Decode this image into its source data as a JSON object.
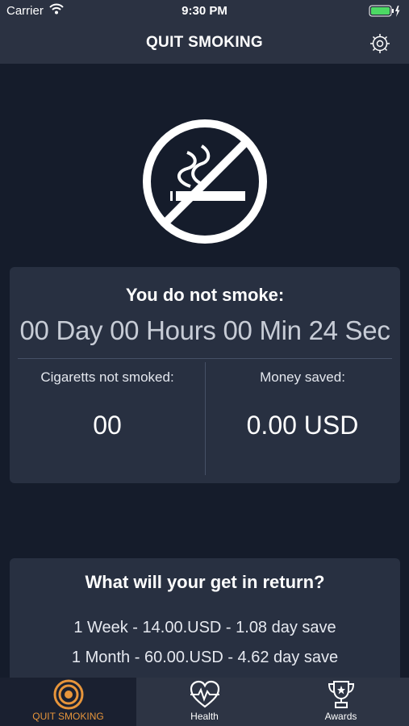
{
  "status_bar": {
    "carrier": "Carrier",
    "time": "9:30 PM"
  },
  "nav": {
    "title": "QUIT SMOKING"
  },
  "main": {
    "you_do_not_smoke_label": "You do not smoke:",
    "timer": "00 Day 00 Hours 00 Min 24 Sec",
    "cigarettes_label": "Cigaretts not smoked:",
    "cigarettes_value": "00",
    "money_label": "Money saved:",
    "money_value": "0.00 USD"
  },
  "returns": {
    "title": "What will your get in return?",
    "rows": [
      "1 Week - 14.00.USD  - 1.08 day save",
      "1 Month - 60.00.USD  - 4.62 day save"
    ]
  },
  "tabs": [
    {
      "label": "QUIT SMOKING",
      "icon": "target-icon",
      "active": true
    },
    {
      "label": "Health",
      "icon": "heart-pulse-icon",
      "active": false
    },
    {
      "label": "Awards",
      "icon": "trophy-icon",
      "active": false
    }
  ],
  "colors": {
    "accent": "#e7953b",
    "background": "#151c2b",
    "card": "#283041",
    "bar": "#2b3242",
    "battery": "#4cd964"
  }
}
